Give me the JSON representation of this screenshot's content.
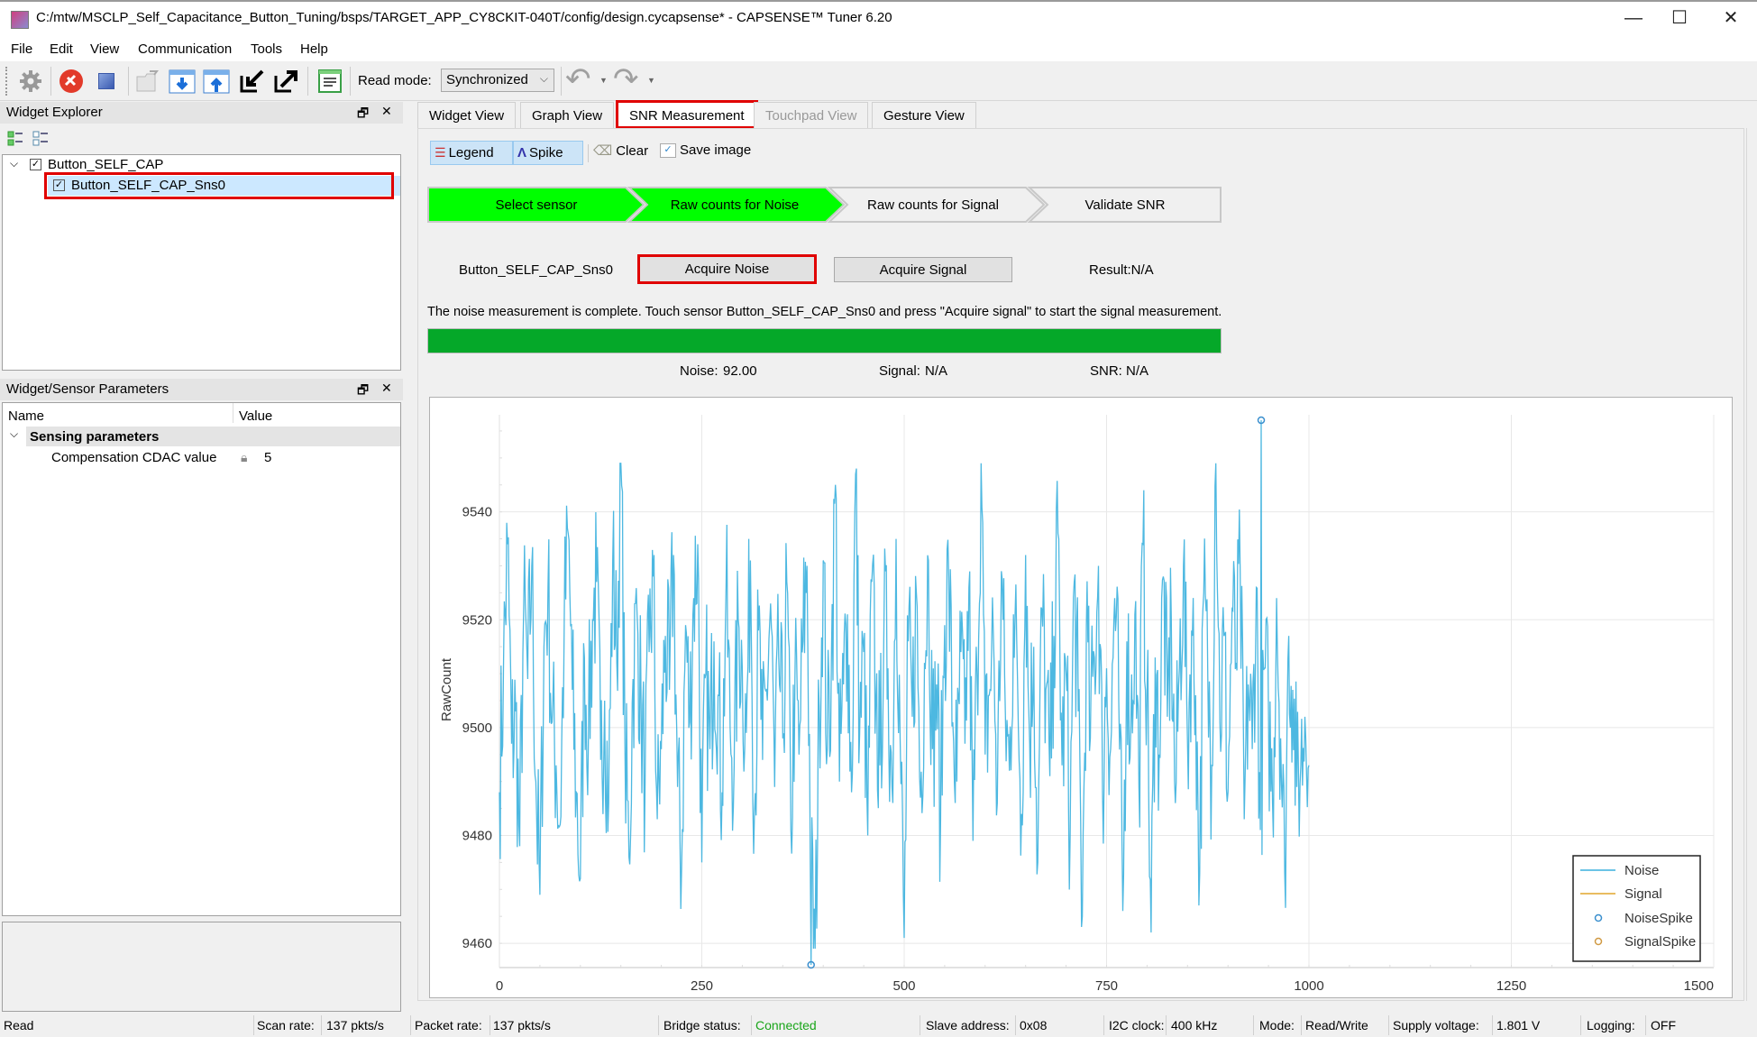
{
  "window": {
    "title": "C:/mtw/MSCLP_Self_Capacitance_Button_Tuning/bsps/TARGET_APP_CY8CKIT-040T/config/design.cycapsense* - CAPSENSE™ Tuner 6.20",
    "controls": {
      "minimize": "—",
      "maximize": "☐",
      "close": "✕"
    }
  },
  "menu": [
    "File",
    "Edit",
    "View",
    "Communication",
    "Tools",
    "Help"
  ],
  "toolbar": {
    "icons": [
      "gear-icon",
      "disconnect-icon",
      "stop-icon",
      "open-folder-icon",
      "read-from-device-icon",
      "write-to-device-icon",
      "import-icon",
      "export-icon",
      "log-icon"
    ],
    "read_mode_label": "Read mode:",
    "read_mode_value": "Synchronized",
    "undo": "↶",
    "redo": "↷"
  },
  "widget_explorer": {
    "title": "Widget Explorer",
    "tree": [
      {
        "label": "Button_SELF_CAP",
        "checked": true,
        "expanded": true,
        "children": [
          {
            "label": "Button_SELF_CAP_Sns0",
            "checked": true,
            "selected": true
          }
        ]
      }
    ]
  },
  "params": {
    "title": "Widget/Sensor Parameters",
    "columns": [
      "Name",
      "Value"
    ],
    "group": "Sensing parameters",
    "rows": [
      {
        "name": "Compensation CDAC value",
        "value": "5",
        "locked": true
      }
    ]
  },
  "tabs": [
    {
      "label": "Widget View",
      "state": "normal"
    },
    {
      "label": "Graph View",
      "state": "normal"
    },
    {
      "label": "SNR Measurement",
      "state": "active"
    },
    {
      "label": "Touchpad View",
      "state": "disabled"
    },
    {
      "label": "Gesture View",
      "state": "normal"
    }
  ],
  "snr": {
    "tools": {
      "legend": "Legend",
      "spike": "Spike",
      "clear": "Clear",
      "save_image": "Save image"
    },
    "steps": [
      {
        "label": "Select sensor",
        "done": true
      },
      {
        "label": "Raw counts for Noise",
        "done": true
      },
      {
        "label": "Raw counts for Signal",
        "done": false
      },
      {
        "label": "Validate SNR",
        "done": false
      }
    ],
    "sensor": "Button_SELF_CAP_Sns0",
    "acquire_noise": "Acquire Noise",
    "acquire_signal": "Acquire Signal",
    "result": "Result:N/A",
    "message": "The noise measurement is complete. Touch sensor Button_SELF_CAP_Sns0 and press \"Acquire signal\" to start the signal measurement.",
    "progress_percent": 100,
    "progress_color": "#05a829",
    "step_done_color": "#00ff00",
    "noise_label": "Noise:",
    "noise_value": "92.00",
    "signal_label": "Signal:",
    "signal_value": "N/A",
    "snr_label": "SNR:",
    "snr_value": "N/A"
  },
  "chart_data": {
    "type": "line",
    "title": "",
    "xlabel": "",
    "ylabel": "RawCount",
    "xlim": [
      0,
      1500
    ],
    "ylim": [
      9455.5,
      9558
    ],
    "xticks": [
      0,
      250,
      500,
      750,
      1000,
      1250,
      1500
    ],
    "yticks": [
      9460,
      9480,
      9500,
      9520,
      9540
    ],
    "grid": true,
    "legend_position": "bottom-right",
    "series": [
      {
        "name": "Noise",
        "color": "#3ab0de",
        "kind": "line",
        "x_start": 0,
        "x_step": 5,
        "values": [
          9488,
          9511,
          9534,
          9497,
          9503,
          9478,
          9522,
          9509,
          9530,
          9490,
          9469,
          9515,
          9526,
          9501,
          9493,
          9482,
          9518,
          9536,
          9507,
          9488,
          9472,
          9513,
          9499,
          9520,
          9527,
          9494,
          9505,
          9486,
          9531,
          9512,
          9551,
          9497,
          9476,
          9509,
          9521,
          9503,
          9490,
          9514,
          9528,
          9483,
          9496,
          9517,
          9507,
          9532,
          9489,
          9474,
          9519,
          9501,
          9524,
          9534,
          9475,
          9510,
          9496,
          9516,
          9506,
          9488,
          9526,
          9500,
          9493,
          9520,
          9511,
          9499,
          9531,
          9484,
          9518,
          9494,
          9507,
          9523,
          9489,
          9513,
          9498,
          9527,
          9481,
          9509,
          9495,
          9516,
          9530,
          9473,
          9457,
          9504,
          9531,
          9496,
          9512,
          9545,
          9490,
          9508,
          9521,
          9488,
          9547,
          9499,
          9514,
          9480,
          9527,
          9505,
          9493,
          9520,
          9511,
          9489,
          9535,
          9498,
          9461,
          9516,
          9502,
          9525,
          9487,
          9512,
          9531,
          9496,
          9508,
          9483,
          9519,
          9528,
          9501,
          9490,
          9514,
          9497,
          9526,
          9479,
          9510,
          9549,
          9495,
          9506,
          9518,
          9486,
          9529,
          9502,
          9492,
          9521,
          9509,
          9484,
          9532,
          9497,
          9515,
          9475,
          9522,
          9507,
          9491,
          9517,
          9536,
          9493,
          9510,
          9480,
          9527,
          9503,
          9465,
          9519,
          9498,
          9513,
          9530,
          9488,
          9511,
          9496,
          9524,
          9505,
          9466,
          9516,
          9500,
          9521,
          9489,
          9534,
          9507,
          9462,
          9513,
          9495,
          9528,
          9502,
          9520,
          9486,
          9511,
          9530,
          9497,
          9518,
          9506,
          9473,
          9525,
          9509,
          9493,
          9557,
          9501,
          9517,
          9488,
          9522,
          9512,
          9529,
          9483,
          9508,
          9496,
          9526,
          9481,
          9511,
          9503,
          9486,
          9524,
          9498,
          9473,
          9517,
          9507,
          9489,
          9493,
          9502
        ],
        "extra_points": [
          [
            1000,
            9493
          ]
        ]
      },
      {
        "name": "Signal",
        "color": "#e2a52c",
        "kind": "line",
        "values": []
      },
      {
        "name": "NoiseSpike",
        "color": "#3a8fce",
        "kind": "marker",
        "points": [
          [
            385,
            9456
          ],
          [
            941,
            9557
          ]
        ]
      },
      {
        "name": "SignalSpike",
        "color": "#d09a44",
        "kind": "marker",
        "points": []
      }
    ]
  },
  "status": {
    "state": "Read",
    "scan_rate_label": "Scan rate:",
    "scan_rate": "137 pkts/s",
    "packet_rate_label": "Packet rate:",
    "packet_rate": "137 pkts/s",
    "bridge_label": "Bridge status:",
    "bridge": "Connected",
    "bridge_color": "#19a519",
    "slave_label": "Slave address:",
    "slave": "0x08",
    "i2c_label": "I2C clock:",
    "i2c": "400 kHz",
    "mode_label": "Mode:",
    "mode": "Read/Write",
    "supply_label": "Supply voltage:",
    "supply": "1.801 V",
    "logging_label": "Logging:",
    "logging": "OFF"
  }
}
